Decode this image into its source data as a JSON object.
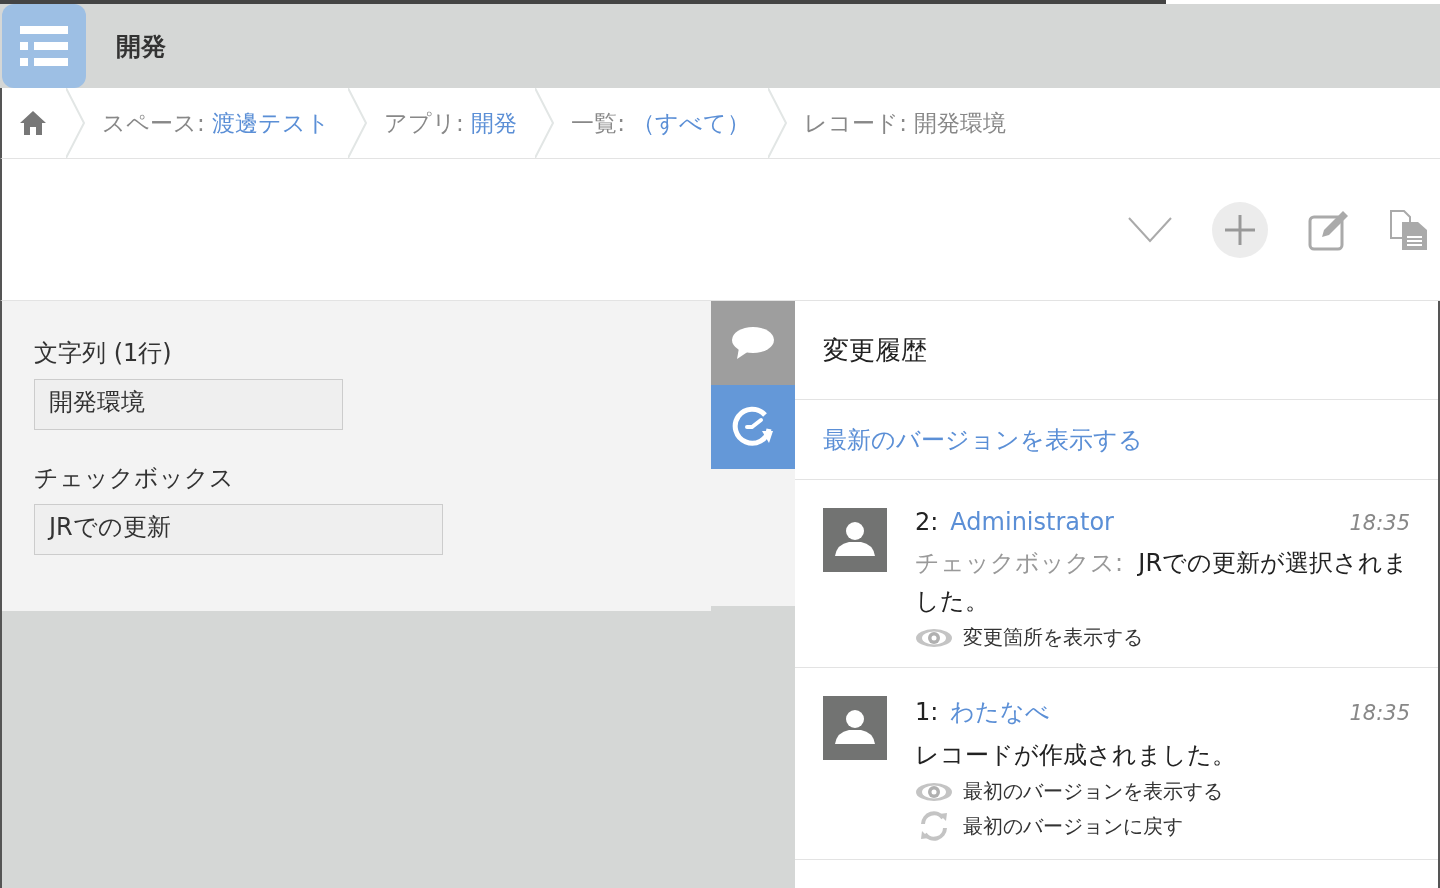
{
  "progress": {
    "level": 0.81
  },
  "app": {
    "title": "開発"
  },
  "breadcrumb": [
    {
      "label": "スペース:",
      "value": "渡邊テスト",
      "link": true
    },
    {
      "label": "アプリ:",
      "value": "開発",
      "link": true
    },
    {
      "label": "一覧:",
      "value": "（すべて）",
      "link": true
    },
    {
      "label": "レコード:",
      "value": "開発環境",
      "link": false
    }
  ],
  "fields": [
    {
      "label": "文字列 (1行)",
      "value": "開発環境"
    },
    {
      "label": "チェックボックス",
      "value": "JRでの更新"
    }
  ],
  "side_tabs": [
    {
      "kind": "comments",
      "selected": false
    },
    {
      "kind": "history",
      "selected": true
    }
  ],
  "history": {
    "title": "変更履歴",
    "latest_link": "最新のバージョンを表示する",
    "entries": [
      {
        "number": "2:",
        "user": "Administrator",
        "time": "18:35",
        "message_label": "チェックボックス:",
        "message": "JRでの更新が選択されました。",
        "actions": [
          {
            "kind": "view",
            "text": "変更箇所を表示する"
          }
        ]
      },
      {
        "number": "1:",
        "user": "わたなべ",
        "time": "18:35",
        "message": "レコードが作成されました。",
        "actions": [
          {
            "kind": "view",
            "text": "最初のバージョンを表示する"
          },
          {
            "kind": "revert",
            "text": "最初のバージョンに戻す"
          }
        ]
      }
    ]
  }
}
